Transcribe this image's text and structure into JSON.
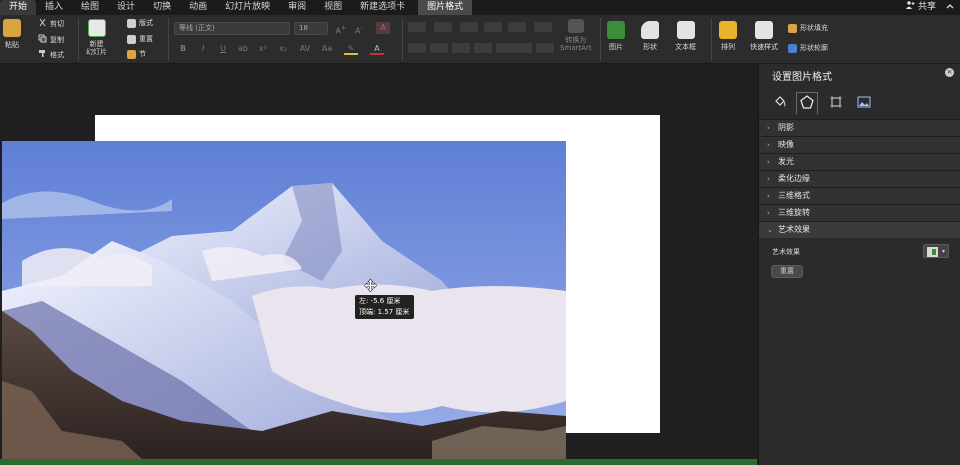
{
  "tabs": [
    {
      "label": "开始",
      "active": true
    },
    {
      "label": "插入"
    },
    {
      "label": "绘图"
    },
    {
      "label": "设计"
    },
    {
      "label": "切换"
    },
    {
      "label": "动画"
    },
    {
      "label": "幻灯片放映"
    },
    {
      "label": "审阅"
    },
    {
      "label": "视图"
    },
    {
      "label": "新建选项卡"
    },
    {
      "label": "图片格式",
      "contextual": true
    }
  ],
  "share_label": "共享",
  "ribbon": {
    "paste": "粘贴",
    "cut": "剪切",
    "copy": "复制",
    "format": "格式",
    "new_slide": "新建\n幻灯片",
    "layout": "版式",
    "reset": "重置",
    "section": "节",
    "font_name": "等线 (正文)",
    "font_size": "18",
    "convert_smartart": "转换为\nSmartArt",
    "picture": "图片",
    "shapes": "形状",
    "textbox": "文本框",
    "arrange": "排列",
    "quick_styles": "快速样式",
    "shape_fill": "形状填充",
    "shape_outline": "形状轮廓"
  },
  "tooltip": {
    "left": "左: -5.6 厘米",
    "top": "顶端: 1.57 厘米"
  },
  "pane": {
    "title": "设置图片格式",
    "sections": [
      {
        "label": "阴影",
        "open": false
      },
      {
        "label": "映像",
        "open": false
      },
      {
        "label": "发光",
        "open": false
      },
      {
        "label": "柔化边缘",
        "open": false
      },
      {
        "label": "三维格式",
        "open": false
      },
      {
        "label": "三维旋转",
        "open": false
      },
      {
        "label": "艺术效果",
        "open": true
      }
    ],
    "art_effect_label": "艺术效果",
    "reset_label": "重置"
  },
  "colors": {
    "accent_green": "#2a6b2f",
    "sky": "#6b8fd8"
  }
}
